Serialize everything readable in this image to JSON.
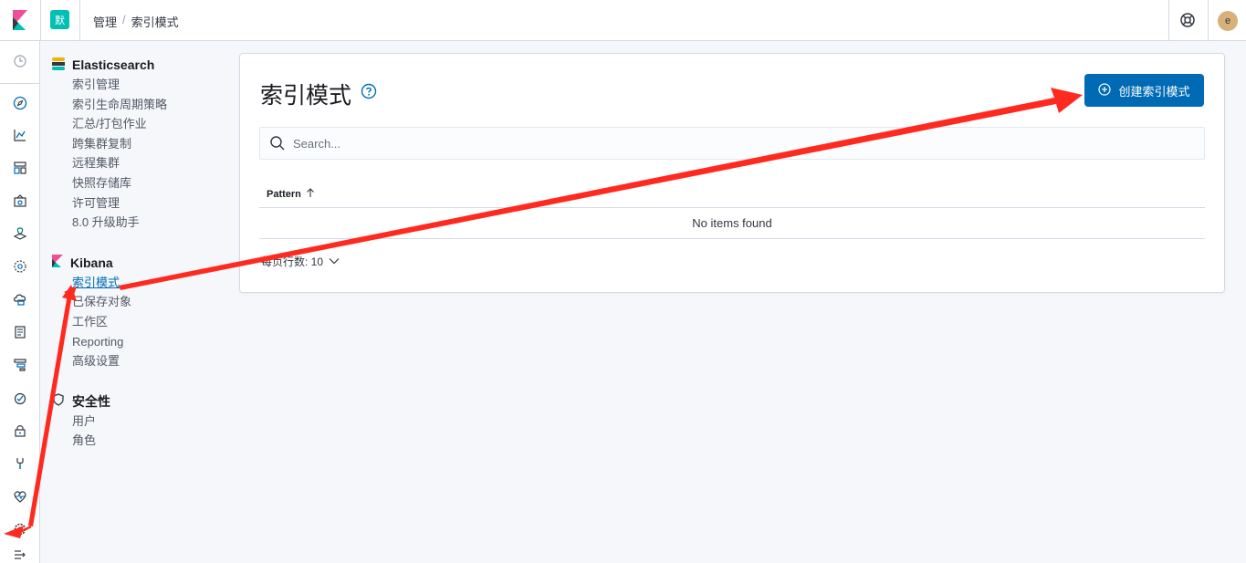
{
  "header": {
    "space_badge": "默",
    "breadcrumbs": [
      "管理",
      "索引模式"
    ],
    "avatar_initial": "e"
  },
  "nav": {
    "icons": [
      "clock-icon",
      "compass-icon",
      "visualize-icon",
      "dashboard-icon",
      "canvas-icon",
      "maps-icon",
      "ml-icon",
      "infrastructure-icon",
      "logs-icon",
      "apm-icon",
      "uptime-icon",
      "siem-icon",
      "dev-tools-icon",
      "monitoring-icon",
      "management-icon",
      "collapse-icon"
    ]
  },
  "sidebar": {
    "sections": [
      {
        "title": "Elasticsearch",
        "items": [
          "索引管理",
          "索引生命周期策略",
          "汇总/打包作业",
          "跨集群复制",
          "远程集群",
          "快照存储库",
          "许可管理",
          "8.0 升级助手"
        ]
      },
      {
        "title": "Kibana",
        "items": [
          "索引模式",
          "已保存对象",
          "工作区",
          "Reporting",
          "高级设置"
        ]
      },
      {
        "title": "安全性",
        "items": [
          "用户",
          "角色"
        ]
      }
    ],
    "active_item": "索引模式"
  },
  "main": {
    "title": "索引模式",
    "create_button": "创建索引模式",
    "search_placeholder": "Search...",
    "table": {
      "column_header": "Pattern",
      "empty_message": "No items found"
    },
    "pager": {
      "label": "每页行数: 10"
    }
  },
  "colors": {
    "primary": "#006bb4",
    "annotation_arrow": "#ff2a1f",
    "space_badge": "#00bfb3"
  }
}
